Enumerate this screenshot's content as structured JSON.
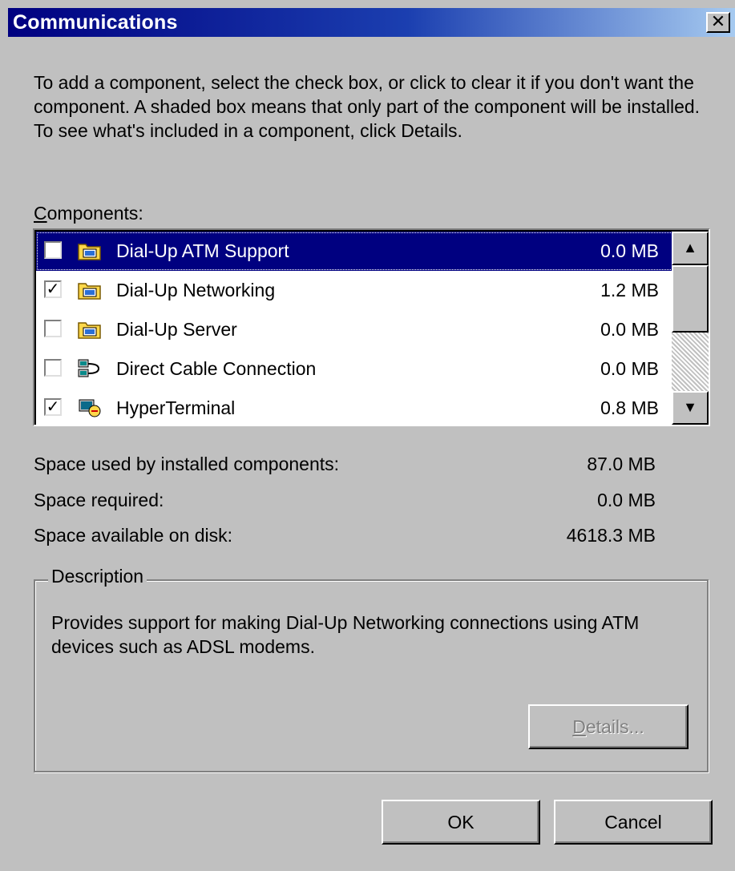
{
  "window": {
    "title": "Communications",
    "close_glyph": "✕"
  },
  "intro_text": "To add a component, select the check box, or click to clear it if you don't want the component. A shaded box means that only part of the component will be installed. To see what's included in a component, click Details.",
  "components": {
    "label_prefix": "C",
    "label_rest": "omponents:",
    "items": [
      {
        "name": "Dial-Up ATM Support",
        "size": "0.0 MB",
        "checked": false,
        "selected": true,
        "icon": "folder-network-icon"
      },
      {
        "name": "Dial-Up Networking",
        "size": "1.2 MB",
        "checked": true,
        "selected": false,
        "icon": "folder-network-icon"
      },
      {
        "name": "Dial-Up Server",
        "size": "0.0 MB",
        "checked": false,
        "selected": false,
        "icon": "folder-network-icon"
      },
      {
        "name": "Direct Cable Connection",
        "size": "0.0 MB",
        "checked": false,
        "selected": false,
        "icon": "cable-connection-icon"
      },
      {
        "name": "HyperTerminal",
        "size": "0.8 MB",
        "checked": true,
        "selected": false,
        "icon": "hyperterminal-icon"
      }
    ],
    "scroll_up_glyph": "▲",
    "scroll_down_glyph": "▼"
  },
  "space": {
    "used_label": "Space used by installed components:",
    "used_value": "87.0 MB",
    "required_label": "Space required:",
    "required_value": "0.0 MB",
    "available_label": "Space available on disk:",
    "available_value": "4618.3 MB"
  },
  "description": {
    "title": "Description",
    "text": "Provides support for making Dial-Up Networking connections using ATM devices such as ADSL modems."
  },
  "buttons": {
    "details_prefix": "D",
    "details_rest": "etails...",
    "ok": "OK",
    "cancel": "Cancel"
  },
  "colors": {
    "selection": "#000080",
    "face": "#c0c0c0"
  }
}
